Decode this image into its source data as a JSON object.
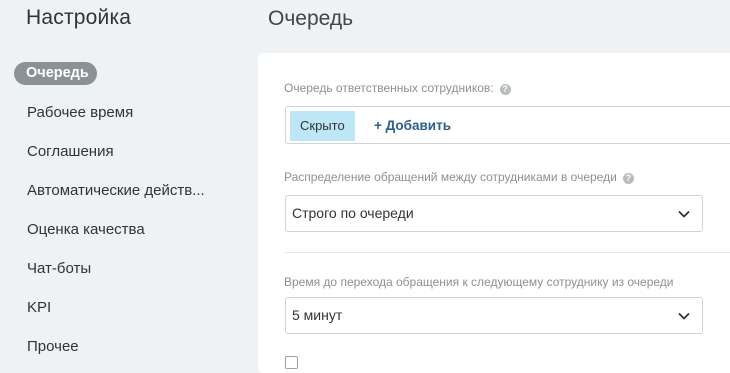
{
  "sidebar": {
    "title": "Настройка",
    "items": [
      {
        "label": "Очередь",
        "active": true
      },
      {
        "label": "Рабочее время"
      },
      {
        "label": "Соглашения"
      },
      {
        "label": "Автоматические действ..."
      },
      {
        "label": "Оценка качества"
      },
      {
        "label": "Чат-боты"
      },
      {
        "label": "KPI"
      },
      {
        "label": "Прочее"
      }
    ]
  },
  "main": {
    "title": "Очередь",
    "responsible": {
      "label": "Очередь ответственных сотрудников:",
      "tag": "Скрыто",
      "add_label": "+ Добавить"
    },
    "distribution": {
      "label": "Распределение обращений между сотрудниками в очереди",
      "value": "Строго по очереди"
    },
    "timeout": {
      "label": "Время до перехода обращения к следующему сотруднику из очереди",
      "value": "5 минут"
    }
  },
  "icons": {
    "help": "help-icon",
    "dropdown": "chevron-down-icon",
    "checkbox": "checkbox-unchecked"
  },
  "colors": {
    "active_nav_bg": "#8b9296",
    "tag_bg": "#bde6f7",
    "link": "#2b5f8c",
    "page_bg": "#eef2f4"
  }
}
